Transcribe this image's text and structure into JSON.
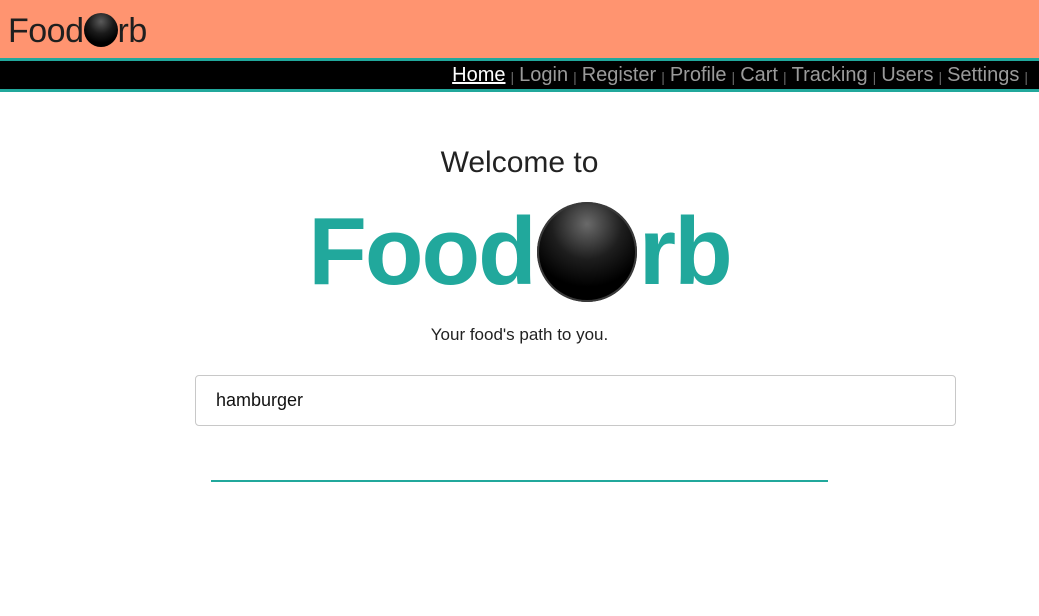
{
  "header": {
    "brand_left": "Food",
    "brand_right": "rb",
    "orb_icon": "black-orb-icon",
    "background_color": "#ff9470"
  },
  "nav": {
    "items": [
      {
        "label": "Home",
        "active": true
      },
      {
        "label": "Login",
        "active": false
      },
      {
        "label": "Register",
        "active": false
      },
      {
        "label": "Profile",
        "active": false
      },
      {
        "label": "Cart",
        "active": false
      },
      {
        "label": "Tracking",
        "active": false
      },
      {
        "label": "Users",
        "active": false
      },
      {
        "label": "Settings",
        "active": false
      }
    ],
    "separator": "|",
    "accent_color": "#21a89c"
  },
  "main": {
    "welcome": "Welcome to",
    "logo_left": "Food",
    "logo_right": "rb",
    "tagline": "Your food's path to you.",
    "search": {
      "value": "hamburger",
      "placeholder": ""
    }
  }
}
